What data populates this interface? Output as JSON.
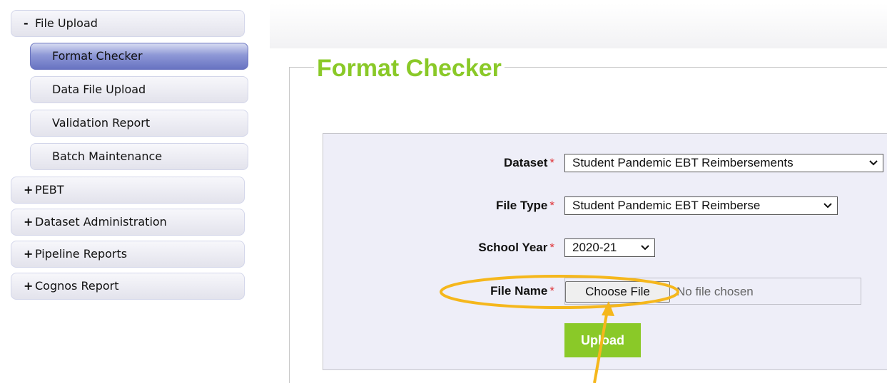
{
  "sidebar": {
    "items": [
      {
        "toggle": "-",
        "label": "File Upload"
      },
      {
        "label": "Format Checker"
      },
      {
        "label": "Data File Upload"
      },
      {
        "label": "Validation Report"
      },
      {
        "label": "Batch Maintenance"
      },
      {
        "toggle": "+",
        "label": "PEBT"
      },
      {
        "toggle": "+",
        "label": "Dataset Administration"
      },
      {
        "toggle": "+",
        "label": "Pipeline Reports"
      },
      {
        "toggle": "+",
        "label": "Cognos Report"
      }
    ],
    "active_item": "Format Checker"
  },
  "main": {
    "title": "Format Checker",
    "form": {
      "required_marker": "*",
      "dataset": {
        "label": "Dataset",
        "value": "Student Pandemic EBT Reimbersements"
      },
      "file_type": {
        "label": "File Type",
        "value": "Student Pandemic EBT Reimberse"
      },
      "school_year": {
        "label": "School Year",
        "value": "2020-21"
      },
      "file_name": {
        "label": "File Name",
        "button_label": "Choose File",
        "status": "No file chosen"
      },
      "upload_label": "Upload"
    }
  },
  "colors": {
    "accent_green": "#8ac928",
    "required_red": "#e0353a",
    "annotation_orange": "#f5b71c",
    "active_nav": "#6873c2"
  }
}
